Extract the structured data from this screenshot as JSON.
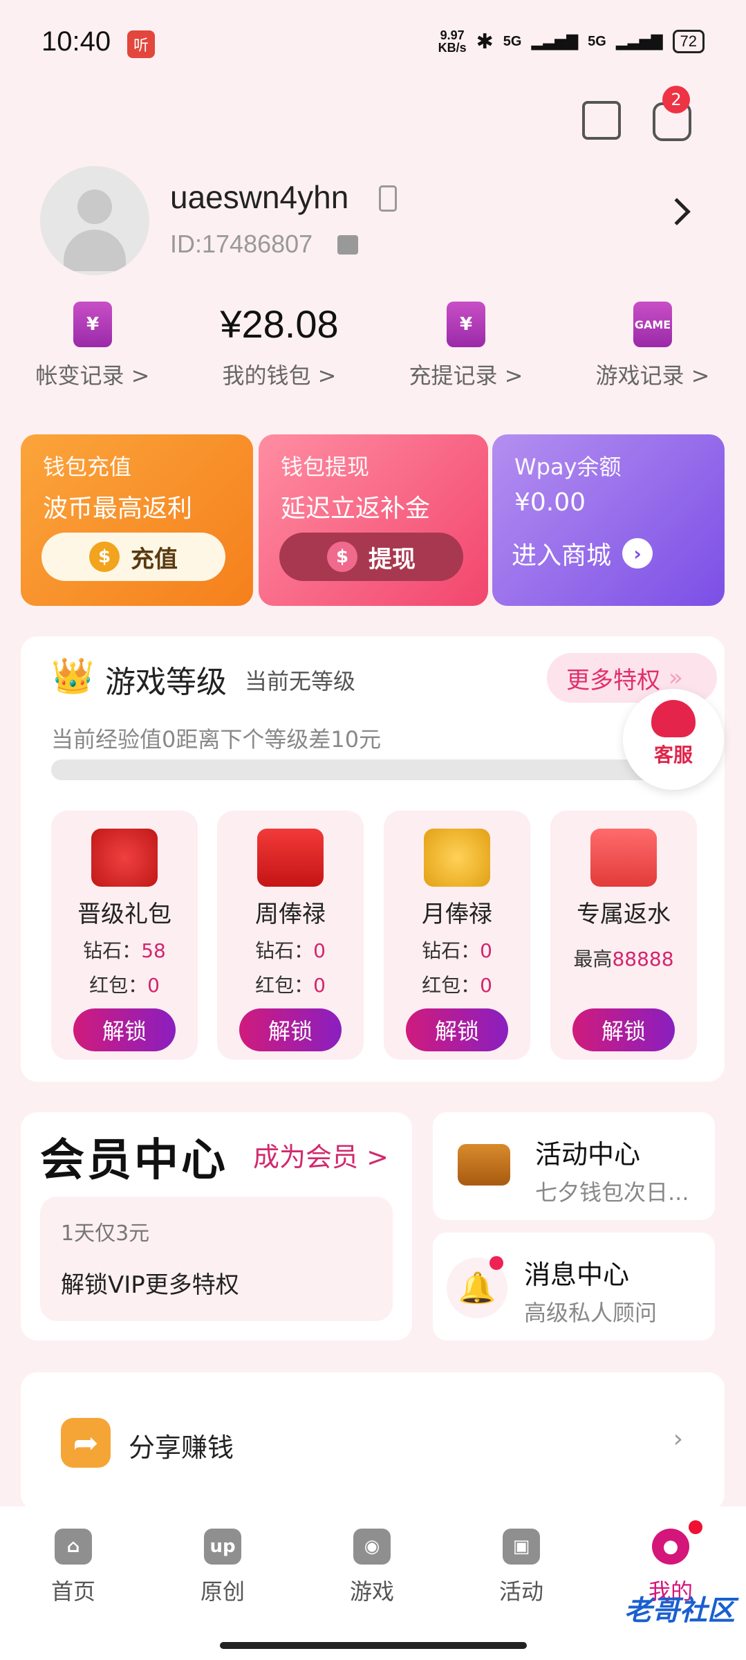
{
  "status": {
    "time": "10:40",
    "app_icon_text": "听",
    "speed_top": "9.97",
    "speed_bottom": "KB/s",
    "sig1": "5G",
    "sig2": "5G",
    "battery": "72"
  },
  "header": {
    "message_badge": "2"
  },
  "profile": {
    "username": "uaeswn4yhn",
    "id_text": "ID:17486807"
  },
  "quick": [
    {
      "label": "帐变记录 >",
      "icon_text": "¥"
    },
    {
      "label": "我的钱包 >",
      "amount": "¥28.08"
    },
    {
      "label": "充提记录 >",
      "icon_text": "¥"
    },
    {
      "label": "游戏记录 >",
      "icon_text": "GAME"
    }
  ],
  "cards": {
    "recharge": {
      "title": "钱包充值",
      "subtitle": "波币最高返利",
      "button": "充值"
    },
    "withdraw": {
      "title": "钱包提现",
      "subtitle": "延迟立返补金",
      "button": "提现"
    },
    "wpay": {
      "title": "Wpay余额",
      "balance": "¥0.00",
      "button": "进入商城"
    }
  },
  "level": {
    "title": "游戏等级",
    "current": "当前无等级",
    "more": "更多特权",
    "exp_text": "当前经验值0距离下个等级差10元",
    "service": "客服",
    "rewards": [
      {
        "name": "晋级礼包",
        "l1_label": "钻石：",
        "l1_val": "58",
        "l2_label": "红包：",
        "l2_val": "0",
        "button": "解锁"
      },
      {
        "name": "周俸禄",
        "l1_label": "钻石：",
        "l1_val": "0",
        "l2_label": "红包：",
        "l2_val": "0",
        "button": "解锁"
      },
      {
        "name": "月俸禄",
        "l1_label": "钻石：",
        "l1_val": "0",
        "l2_label": "红包：",
        "l2_val": "0",
        "button": "解锁"
      },
      {
        "name": "专属返水",
        "l1_label": "最高",
        "l1_val": "88888",
        "button": "解锁"
      }
    ]
  },
  "member": {
    "title": "会员中心",
    "become": "成为会员 >",
    "price": "1天仅3元",
    "desc": "解锁VIP更多特权"
  },
  "activity": {
    "title": "活动中心",
    "subtitle": "七夕钱包次日..."
  },
  "message": {
    "title": "消息中心",
    "subtitle": "高级私人顾问"
  },
  "share": {
    "label": "分享赚钱"
  },
  "tabs": [
    {
      "label": "首页",
      "icon": "home-icon"
    },
    {
      "label": "原创",
      "icon_text": "up"
    },
    {
      "label": "游戏",
      "icon": "gamepad-icon"
    },
    {
      "label": "活动",
      "icon": "gift-icon"
    },
    {
      "label": "我的",
      "icon": "user-icon"
    }
  ],
  "watermark": "老哥社区"
}
